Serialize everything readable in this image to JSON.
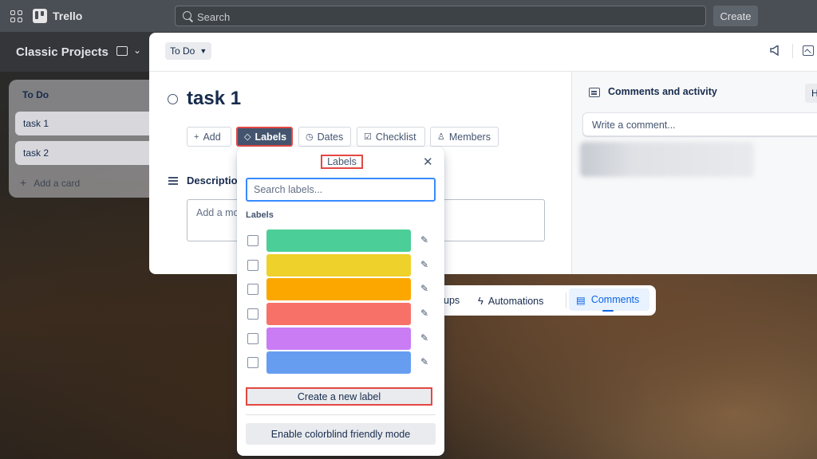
{
  "topbar": {
    "app_name": "Trello",
    "search_placeholder": "Search",
    "create_label": "Create"
  },
  "board": {
    "title": "Classic Projects",
    "list": {
      "title": "To Do",
      "cards": [
        "task 1",
        "task 2"
      ],
      "add_card_label": "Add a card"
    }
  },
  "card_modal": {
    "list_status": "To Do",
    "title": "task 1",
    "actions": {
      "add": "Add",
      "labels": "Labels",
      "dates": "Dates",
      "checklist": "Checklist",
      "members": "Members"
    },
    "description": {
      "label": "Description",
      "placeholder": "Add a mo"
    },
    "side_panel": {
      "title": "Comments and activity",
      "hide_label": "H",
      "comment_placeholder": "Write a comment..."
    }
  },
  "bottom_bar": {
    "partial_label": "ups",
    "automations": "Automations",
    "comments": "Comments"
  },
  "labels_popover": {
    "title": "Labels",
    "search_placeholder": "Search labels...",
    "section_label": "Labels",
    "colors": [
      "#4bce97",
      "#eed12b",
      "#fca700",
      "#f87168",
      "#c97cf4",
      "#669df1"
    ],
    "create_label": "Create a new label",
    "colorblind_label": "Enable colorblind friendly mode"
  }
}
